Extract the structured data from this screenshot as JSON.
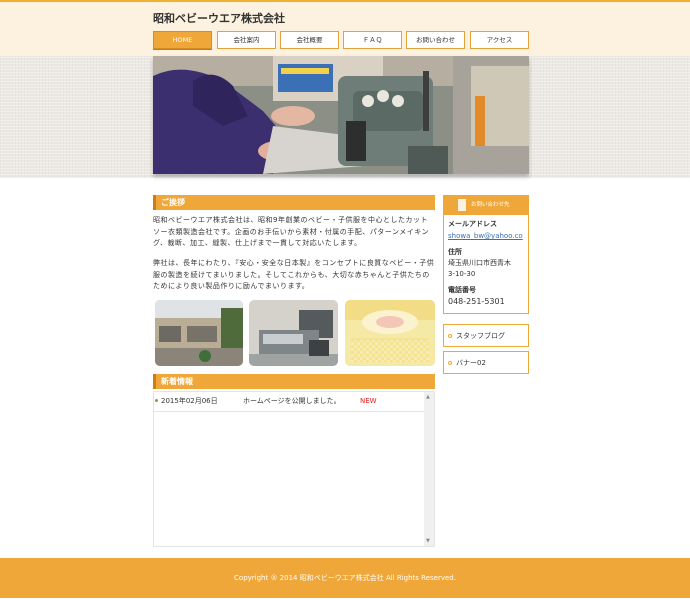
{
  "site": {
    "title": "昭和ベビーウエア株式会社"
  },
  "nav": [
    {
      "label": "HOME",
      "active": true
    },
    {
      "label": "会社案内"
    },
    {
      "label": "会社概要"
    },
    {
      "label": "ＦＡＱ"
    },
    {
      "label": "お問い合わせ"
    },
    {
      "label": "アクセス"
    }
  ],
  "greeting": {
    "heading": "ご挨拶",
    "paragraphs": [
      "昭和ベビーウエア株式会社は、昭和9年創業のベビー・子供服を中心としたカットソー衣類製造会社です。企画のお手伝いから素材・付属の手配、パターンメイキング、裁断、加工、縫製、仕上げまで一貫して対応いたします。",
      "弊社は、長年にわたり、『安心・安全な日本製』をコンセプトに良質なベビー・子供服の製造を続けてまいりました。そしてこれからも、大切な赤ちゃんと子供たちのためにより良い製品作りに励んでまいります。"
    ]
  },
  "news": {
    "heading": "新着情報",
    "items": [
      {
        "date": "2015年02月06日",
        "text": "ホームページを公開しました。",
        "badge": "NEW"
      }
    ]
  },
  "sidebar": {
    "contact_heading": "お問い合わせ先",
    "email_label": "メールアドレス",
    "email": "showa_bw@yahoo.co",
    "address_label": "住所",
    "address_line1": "埼玉県川口市西青木",
    "address_line2": "3-10-30",
    "phone_label": "電話番号",
    "phone": "048-251-5301",
    "banners": [
      {
        "label": "スタッフブログ"
      },
      {
        "label": "バナー02"
      }
    ]
  },
  "footer": {
    "copyright": "Copyright ® 2014 昭和ベビーウエア株式会社 All Rights Reserved."
  },
  "colors": {
    "accent": "#f0a73a",
    "accent_dark": "#d07d10",
    "header_bg": "#fdf1df",
    "link": "#3a6fb0",
    "new_badge": "#e02020"
  }
}
